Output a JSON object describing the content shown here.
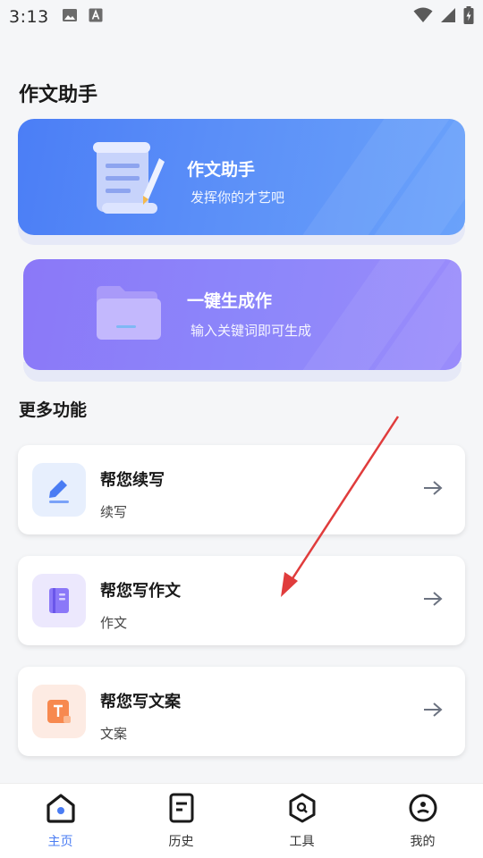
{
  "status_bar": {
    "time": "3:13",
    "icons": [
      "image-icon",
      "a-icon",
      "wifi-icon",
      "signal-icon",
      "battery-charging-icon"
    ]
  },
  "page": {
    "title": "作文助手"
  },
  "hero_cards": [
    {
      "title": "作文助手",
      "subtitle": "发挥你的才艺吧",
      "icon": "scroll-pen-icon"
    },
    {
      "title": "一键生成作",
      "subtitle": "输入关键词即可生成",
      "icon": "folder-icon"
    }
  ],
  "more": {
    "title": "更多功能",
    "items": [
      {
        "title": "帮您续写",
        "subtitle": "续写",
        "icon": "pen-icon"
      },
      {
        "title": "帮您写作文",
        "subtitle": "作文",
        "icon": "book-icon"
      },
      {
        "title": "帮您写文案",
        "subtitle": "文案",
        "icon": "text-document-icon"
      }
    ]
  },
  "tabs": [
    {
      "label": "主页",
      "icon": "home-icon",
      "active": true
    },
    {
      "label": "历史",
      "icon": "history-icon",
      "active": false
    },
    {
      "label": "工具",
      "icon": "tools-icon",
      "active": false
    },
    {
      "label": "我的",
      "icon": "profile-icon",
      "active": false
    }
  ],
  "colors": {
    "accent": "#4a7cf3",
    "hero_blue": "#4b7ef6",
    "hero_purple": "#8b78f8",
    "annotation_arrow": "#e03c3c"
  }
}
